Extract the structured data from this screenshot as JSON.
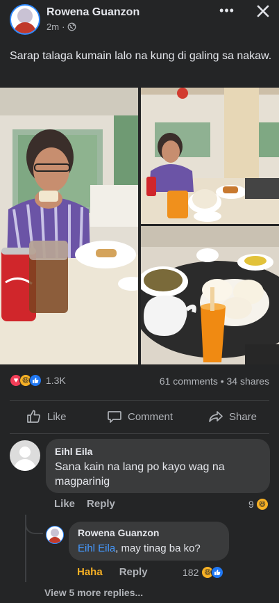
{
  "post": {
    "author": "Rowena Guanzon",
    "time": "2m",
    "separator": "·",
    "caption": "Sarap talaga kumain lalo na kung di galing sa nakaw."
  },
  "header": {
    "more_label": "•••"
  },
  "reactions": {
    "count": "1.3K",
    "types": [
      "love-icon",
      "haha-icon",
      "like-icon"
    ],
    "stats": "61 comments • 34 shares"
  },
  "actions": {
    "like": "Like",
    "comment": "Comment",
    "share": "Share"
  },
  "comments": [
    {
      "name": "Eihl Eila",
      "text": "Sana kain na lang po kayo wag na magparinig",
      "like_label": "Like",
      "reply_label": "Reply",
      "reaction_count": "9"
    }
  ],
  "reply": {
    "name": "Rowena Guanzon",
    "mention": "Eihl Eila",
    "text": ", may tinag ba ko?",
    "haha_label": "Haha",
    "reply_label": "Reply",
    "reaction_count": "182"
  },
  "view_more": "View 5 more replies...",
  "colors": {
    "background": "#242526",
    "bubble": "#3a3b3c",
    "accent": "#2d88ff",
    "mention": "#4599ff",
    "haha": "#f7b125"
  }
}
